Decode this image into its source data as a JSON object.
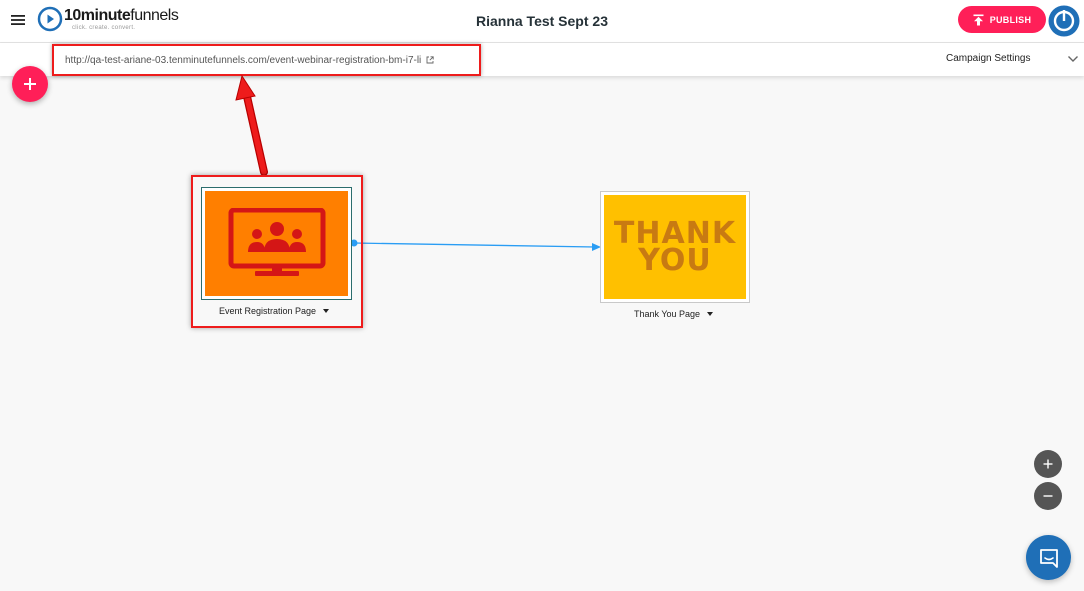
{
  "header": {
    "logo_bold": "10minute",
    "logo_light": "funnels",
    "logo_tagline": "click. create. convert.",
    "campaign_title": "Rianna Test Sept 23",
    "publish_label": "PUBLISH"
  },
  "url_bar": {
    "url": "http://qa-test-ariane-03.tenminutefunnels.com/event-webinar-registration-bm-i7-li",
    "campaign_settings_label": "Campaign Settings"
  },
  "funnel": {
    "pages": [
      {
        "label": "Event Registration Page",
        "thumbnail_icon": "webinar-monitor-icon"
      },
      {
        "label": "Thank You Page",
        "thumbnail_text_line1": "THANK",
        "thumbnail_text_line2": "YOU"
      }
    ]
  },
  "colors": {
    "accent": "#ff1f58",
    "annotation_red": "#ee1c1c",
    "connector_blue": "#2a9df4",
    "event_thumb": "#ff7f00",
    "thanks_thumb": "#ffc000",
    "chat_blue": "#1f6fb7"
  },
  "icons": {
    "menu": "hamburger-icon",
    "publish": "upload-icon",
    "external_link": "external-link-icon",
    "settings_toggle": "chevron-down-icon",
    "add": "plus-icon",
    "zoom_in": "zoom-in-icon",
    "zoom_out": "zoom-out-icon",
    "chat": "chat-icon"
  }
}
